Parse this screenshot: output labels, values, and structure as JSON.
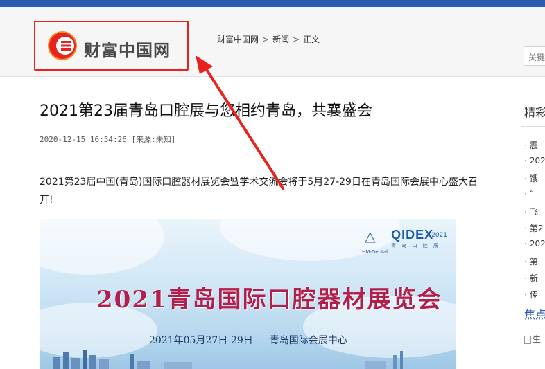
{
  "header": {
    "logo_text": "财富中国网",
    "breadcrumb": [
      "财富中国网",
      "新闻",
      "正文"
    ],
    "breadcrumb_sep": ">",
    "search_placeholder": "关键"
  },
  "article": {
    "title": "2021第23届青岛口腔展与您相约青岛，共襄盛会",
    "meta": "2020-12-15 16:54:26 [来源:未知]",
    "body": "2021第23届中国(青岛)国际口腔器材展览会暨学术交流会将于5月27-29日在青岛国际会展中心盛大召开!"
  },
  "banner": {
    "brand": "QIDEX",
    "brand_year": "2021",
    "brand_sub": "青 岛 口 腔 展",
    "brand_mark": "HM-Dental",
    "title": "2021青岛国际口腔器材展览会",
    "date": "2021年05月27日-29日",
    "venue": "青岛国际会展中心"
  },
  "sidebar": {
    "section_title": "精彩",
    "items": [
      "震",
      "202",
      "饿",
      "“",
      "飞",
      "第2",
      "202",
      "第",
      "新",
      "传"
    ],
    "focus_title": "焦点",
    "image_alt": "生"
  },
  "colors": {
    "top_bar": "#2a5db0",
    "highlight_box": "#e8231f",
    "annotation_arrow": "#e8231f",
    "banner_title": "#b21f4a",
    "focus_title": "#2a5db0"
  }
}
